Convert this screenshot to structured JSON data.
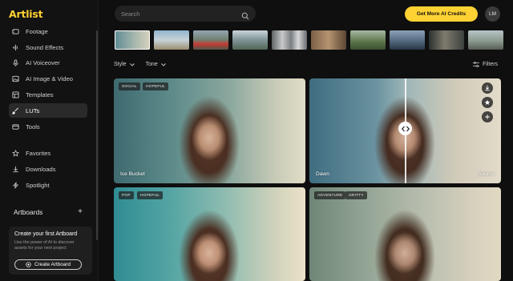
{
  "app": {
    "logo": "Artlist"
  },
  "sidebar": {
    "items": [
      {
        "label": "Footage",
        "icon": "film-icon"
      },
      {
        "label": "Sound Effects",
        "icon": "waveform-icon"
      },
      {
        "label": "AI Voiceover",
        "icon": "microphone-icon"
      },
      {
        "label": "AI Image & Video",
        "icon": "image-icon"
      },
      {
        "label": "Templates",
        "icon": "templates-icon"
      },
      {
        "label": "LUTs",
        "icon": "brush-icon",
        "active": true
      },
      {
        "label": "Tools",
        "icon": "tools-icon"
      },
      {
        "label": "Favorites",
        "icon": "star-icon"
      },
      {
        "label": "Downloads",
        "icon": "download-icon"
      },
      {
        "label": "Spotlight",
        "icon": "lightning-icon"
      }
    ],
    "artboards_title": "Artboards",
    "artboard_card": {
      "title": "Create your first Artboard",
      "description": "Use the power of AI to discover assets for your next project",
      "button": "Create Artboard"
    }
  },
  "search": {
    "placeholder": "Search",
    "value": ""
  },
  "header": {
    "cta": "Get More AI Credits",
    "avatar": "LM"
  },
  "filters": {
    "style": "Style",
    "tone": "Tone",
    "filters_button": "Filters"
  },
  "cards": [
    {
      "tags": [
        "SOCIAL",
        "HOPEFUL"
      ],
      "label_left": "Ice Bucket",
      "label_right": ""
    },
    {
      "tags": [],
      "label_left": "Dawn",
      "label_right": "Source"
    },
    {
      "tags": [
        "POP",
        "HOPEFUL"
      ],
      "label_left": "",
      "label_right": ""
    },
    {
      "tags": [
        "ADVENTURE",
        "GRITTY"
      ],
      "label_left": "",
      "label_right": ""
    }
  ],
  "colors": {
    "accent": "#ffd233",
    "background": "#0f0f0f",
    "sidebar": "#121212"
  }
}
